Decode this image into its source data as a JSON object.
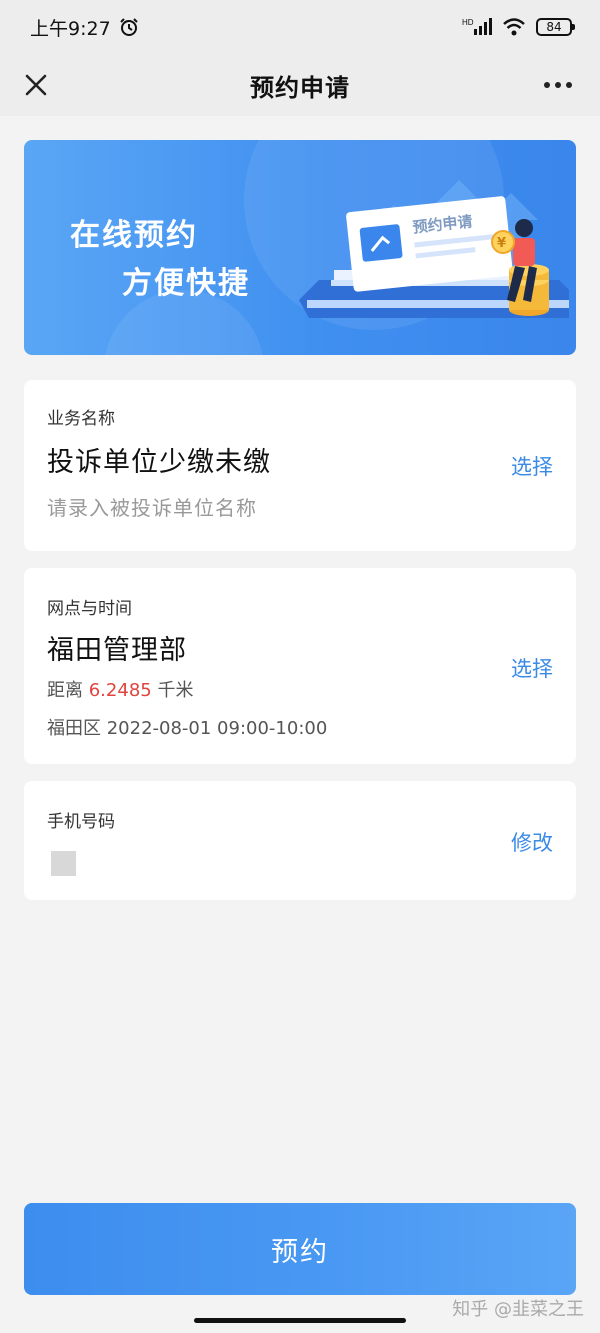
{
  "status": {
    "time": "上午9:27",
    "battery": "84",
    "network": "HD"
  },
  "nav": {
    "title": "预约申请"
  },
  "banner": {
    "line1": "在线预约",
    "line2": "方便快捷",
    "card_text": "预约申请",
    "coin_symbol": "¥"
  },
  "service": {
    "label": "业务名称",
    "value": "投诉单位少缴未缴",
    "action": "选择",
    "placeholder": "请录入被投诉单位名称"
  },
  "branch": {
    "label": "网点与时间",
    "value": "福田管理部",
    "distance_prefix": "距离",
    "distance_value": "6.2485",
    "distance_unit": "千米",
    "datetime": "福田区 2022-08-01 09:00-10:00",
    "action": "选择"
  },
  "phone": {
    "label": "手机号码",
    "action": "修改"
  },
  "submit": {
    "label": "预约"
  },
  "watermark": "知乎 @韭菜之王",
  "colors": {
    "accent": "#3b8ae6",
    "distance": "#e0443e",
    "background": "#f3f3f3"
  }
}
